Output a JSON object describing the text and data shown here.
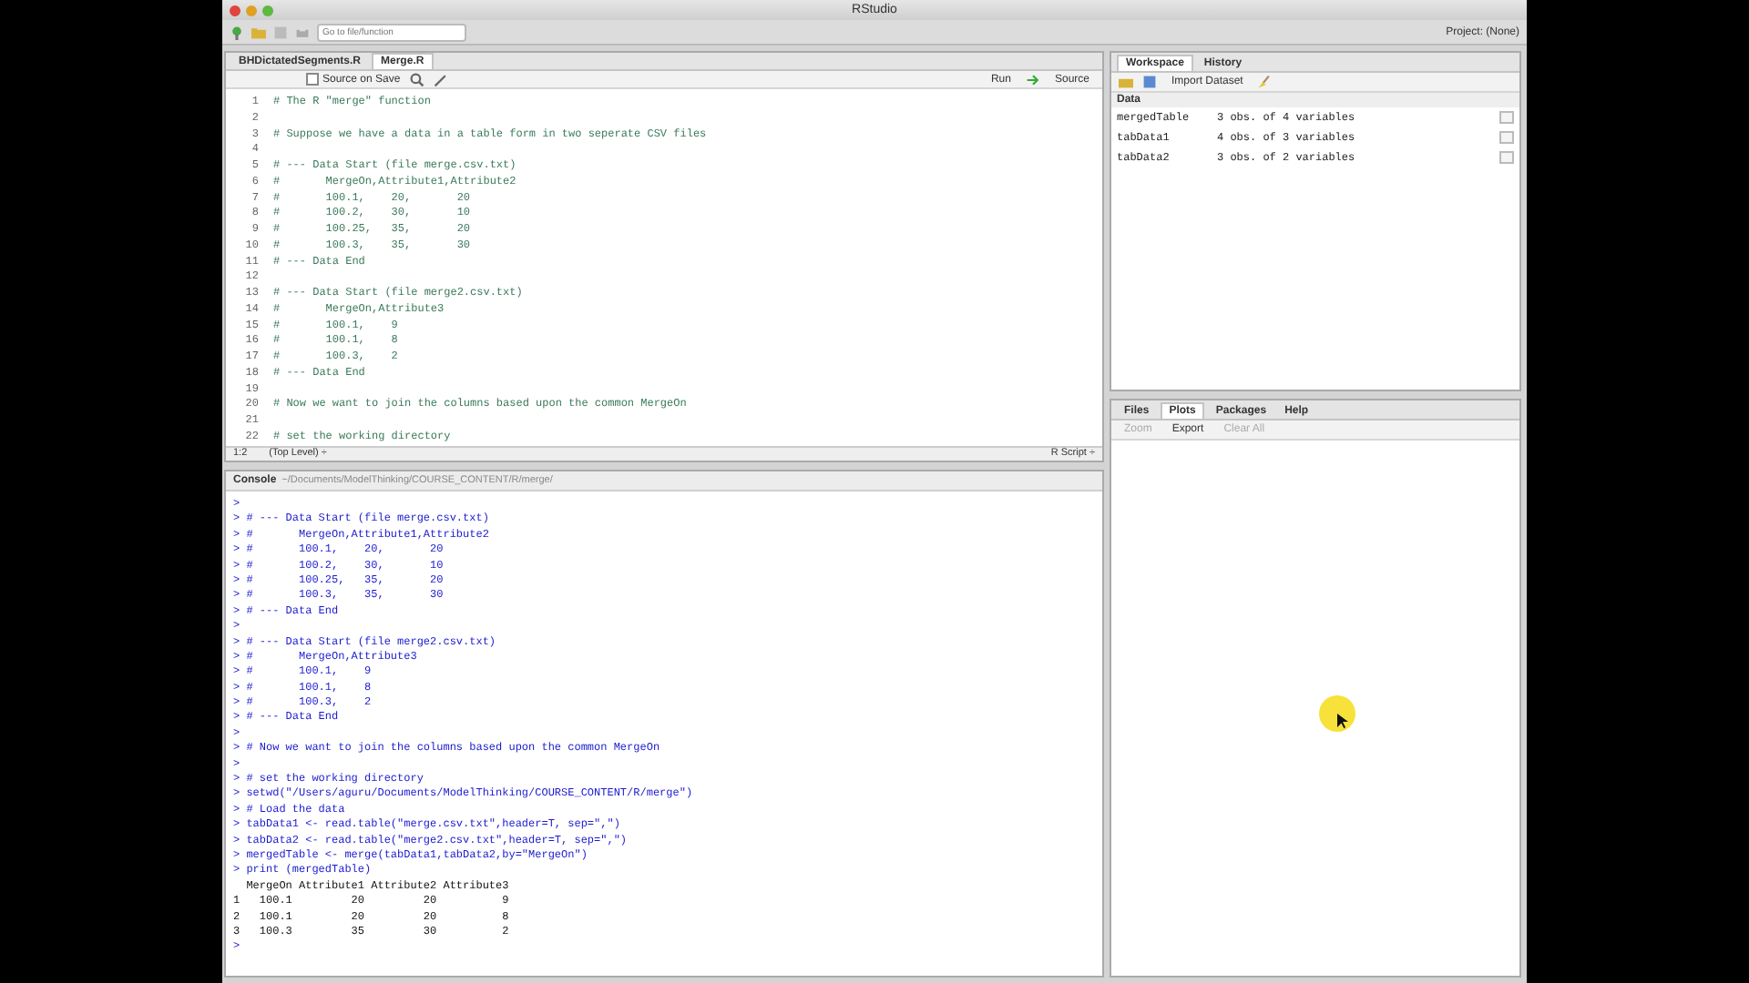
{
  "window": {
    "title": "RStudio",
    "project": "Project: (None)"
  },
  "toolbar": {
    "goto_placeholder": "Go to file/function"
  },
  "editor": {
    "tabs": [
      {
        "label": "BHDictatedSegments.R",
        "selected": false
      },
      {
        "label": "Merge.R",
        "selected": true
      }
    ],
    "source_on_save": {
      "label": "Source on Save",
      "checked": false
    },
    "run_label": "Run",
    "source_label": "Source",
    "lines": [
      {
        "number": "1",
        "text": "# The R \"merge\" function"
      },
      {
        "number": "2"
      },
      {
        "number": "3",
        "text": "# Suppose we have a data in a table form in two seperate CSV files"
      },
      {
        "number": "4"
      },
      {
        "number": "5",
        "text": "# --- Data Start (file merge.csv.txt)"
      },
      {
        "number": "6",
        "text": "#       MergeOn,Attribute1,Attribute2"
      },
      {
        "number": "7",
        "text": "#       100.1,    20,       20"
      },
      {
        "number": "8",
        "text": "#       100.2,    30,       10"
      },
      {
        "number": "9",
        "text": "#       100.25,   35,       20"
      },
      {
        "number": "10",
        "text": "#       100.3,    35,       30"
      },
      {
        "number": "11",
        "text": "# --- Data End"
      },
      {
        "number": "12"
      },
      {
        "number": "13",
        "text": "# --- Data Start (file merge2.csv.txt)"
      },
      {
        "number": "14",
        "text": "#       MergeOn,Attribute3"
      },
      {
        "number": "15",
        "text": "#       100.1,    9"
      },
      {
        "number": "16",
        "text": "#       100.1,    8"
      },
      {
        "number": "17",
        "text": "#       100.3,    2"
      },
      {
        "number": "18",
        "text": "# --- Data End"
      },
      {
        "number": "19"
      },
      {
        "number": "20",
        "text": "# Now we want to join the columns based upon the common MergeOn"
      },
      {
        "number": "21"
      },
      {
        "number": "22",
        "text": "# set the working directory"
      }
    ],
    "status": {
      "position": "1:2",
      "scope": "(Top Level) ÷",
      "filetype": "R Script ÷"
    }
  },
  "console": {
    "title": "Console",
    "path": "~/Documents/ModelThinking/COURSE_CONTENT/R/merge/",
    "lines": [
      {
        "kind": "input",
        "text": ">"
      },
      {
        "kind": "input",
        "text": "> # --- Data Start (file merge.csv.txt)"
      },
      {
        "kind": "input",
        "text": "> #       MergeOn,Attribute1,Attribute2"
      },
      {
        "kind": "input",
        "text": "> #       100.1,    20,       20"
      },
      {
        "kind": "input",
        "text": "> #       100.2,    30,       10"
      },
      {
        "kind": "input",
        "text": "> #       100.25,   35,       20"
      },
      {
        "kind": "input",
        "text": "> #       100.3,    35,       30"
      },
      {
        "kind": "input",
        "text": "> # --- Data End"
      },
      {
        "kind": "input",
        "text": ">"
      },
      {
        "kind": "input",
        "text": "> # --- Data Start (file merge2.csv.txt)"
      },
      {
        "kind": "input",
        "text": "> #       MergeOn,Attribute3"
      },
      {
        "kind": "input",
        "text": "> #       100.1,    9"
      },
      {
        "kind": "input",
        "text": "> #       100.1,    8"
      },
      {
        "kind": "input",
        "text": "> #       100.3,    2"
      },
      {
        "kind": "input",
        "text": "> # --- Data End"
      },
      {
        "kind": "input",
        "text": ">"
      },
      {
        "kind": "input",
        "text": "> # Now we want to join the columns based upon the common MergeOn"
      },
      {
        "kind": "input",
        "text": ">"
      },
      {
        "kind": "input",
        "text": "> # set the working directory"
      },
      {
        "kind": "input",
        "text": "> setwd(\"/Users/aguru/Documents/ModelThinking/COURSE_CONTENT/R/merge\")"
      },
      {
        "kind": "input",
        "text": "> # Load the data"
      },
      {
        "kind": "input",
        "text": "> tabData1 <- read.table(\"merge.csv.txt\",header=T, sep=\",\")"
      },
      {
        "kind": "input",
        "text": "> tabData2 <- read.table(\"merge2.csv.txt\",header=T, sep=\",\")"
      },
      {
        "kind": "input",
        "text": "> mergedTable <- merge(tabData1,tabData2,by=\"MergeOn\")"
      },
      {
        "kind": "input",
        "text": "> print (mergedTable)"
      },
      {
        "kind": "output",
        "text": "  MergeOn Attribute1 Attribute2 Attribute3"
      },
      {
        "kind": "output",
        "text": "1   100.1         20         20          9"
      },
      {
        "kind": "output",
        "text": "2   100.1         20         20          8"
      },
      {
        "kind": "output",
        "text": "3   100.3         35         30          2"
      },
      {
        "kind": "input",
        "text": ">"
      }
    ]
  },
  "workspace": {
    "tabs": [
      {
        "label": "Workspace",
        "selected": true
      },
      {
        "label": "History",
        "selected": false
      }
    ],
    "import_label": "Import Dataset",
    "section": "Data",
    "rows": [
      {
        "name": "mergedTable",
        "value": "3 obs. of 4 variables"
      },
      {
        "name": "tabData1",
        "value": "4 obs. of 3 variables"
      },
      {
        "name": "tabData2",
        "value": "3 obs. of 2 variables"
      }
    ]
  },
  "files": {
    "tabs": [
      {
        "label": "Files",
        "selected": false
      },
      {
        "label": "Plots",
        "selected": true
      },
      {
        "label": "Packages",
        "selected": false
      },
      {
        "label": "Help",
        "selected": false
      }
    ],
    "tools": [
      {
        "label": "Zoom",
        "disabled": true
      },
      {
        "label": "Export",
        "disabled": false
      },
      {
        "label": "Clear All",
        "disabled": true
      }
    ]
  }
}
